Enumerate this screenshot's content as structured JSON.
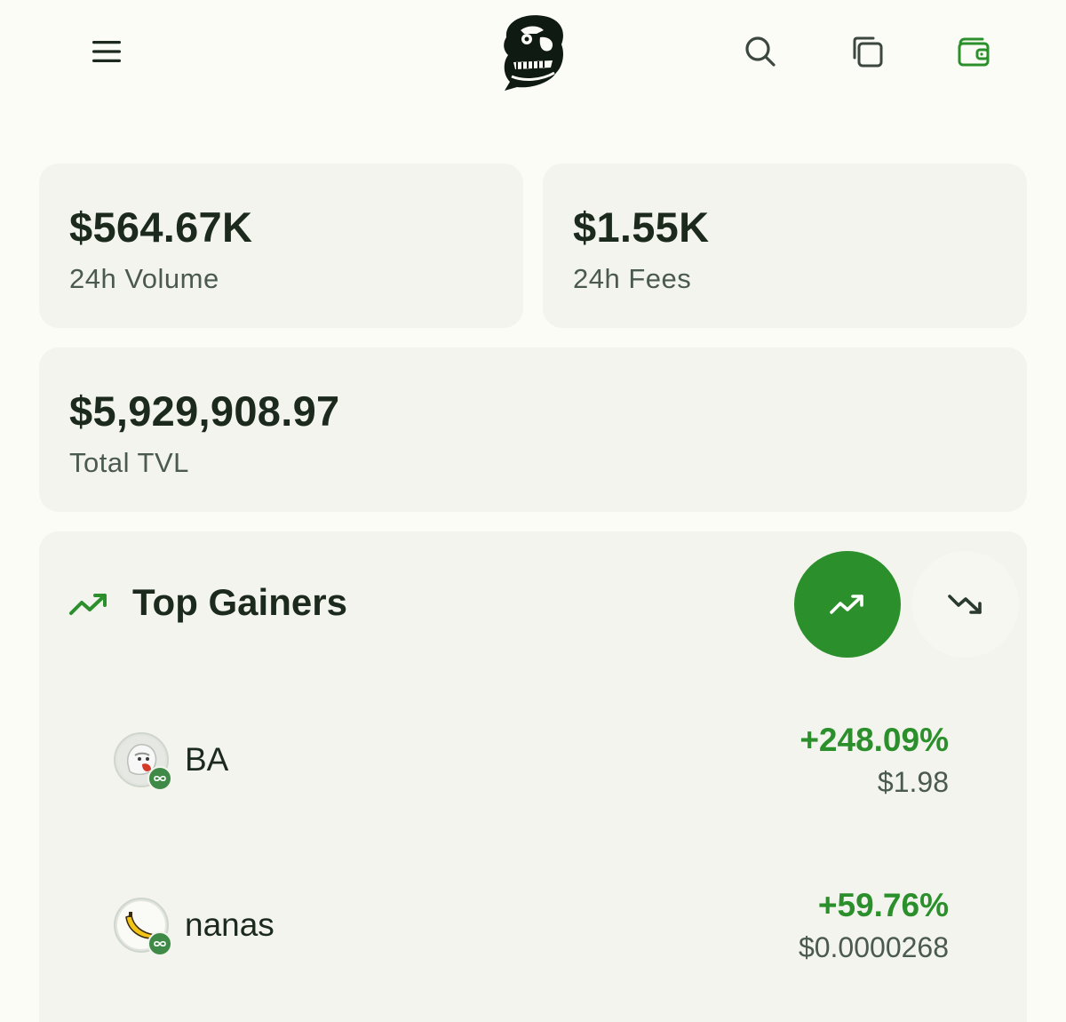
{
  "header": {
    "menu_icon": "hamburger-menu-icon",
    "logo": "gorilla-logo",
    "search_icon": "search-icon",
    "copy_icon": "copy-icon",
    "wallet_icon": "wallet-icon",
    "accent_color": "#2b8f2b"
  },
  "stats": {
    "volume": {
      "value": "$564.67K",
      "label": "24h Volume"
    },
    "fees": {
      "value": "$1.55K",
      "label": "24h Fees"
    },
    "tvl": {
      "value": "$5,929,908.97",
      "label": "Total TVL"
    }
  },
  "gainers": {
    "title": "Top Gainers",
    "title_icon": "trending-up-icon",
    "toggle_up_icon": "trending-up-icon",
    "toggle_down_icon": "trending-down-icon",
    "selected": "up",
    "rows": [
      {
        "name": "BA",
        "change": "+248.09%",
        "price": "$1.98",
        "icon": "gorilla-token-icon"
      },
      {
        "name": "nanas",
        "change": "+59.76%",
        "price": "$0.0000268",
        "icon": "banana-token-icon"
      }
    ]
  }
}
